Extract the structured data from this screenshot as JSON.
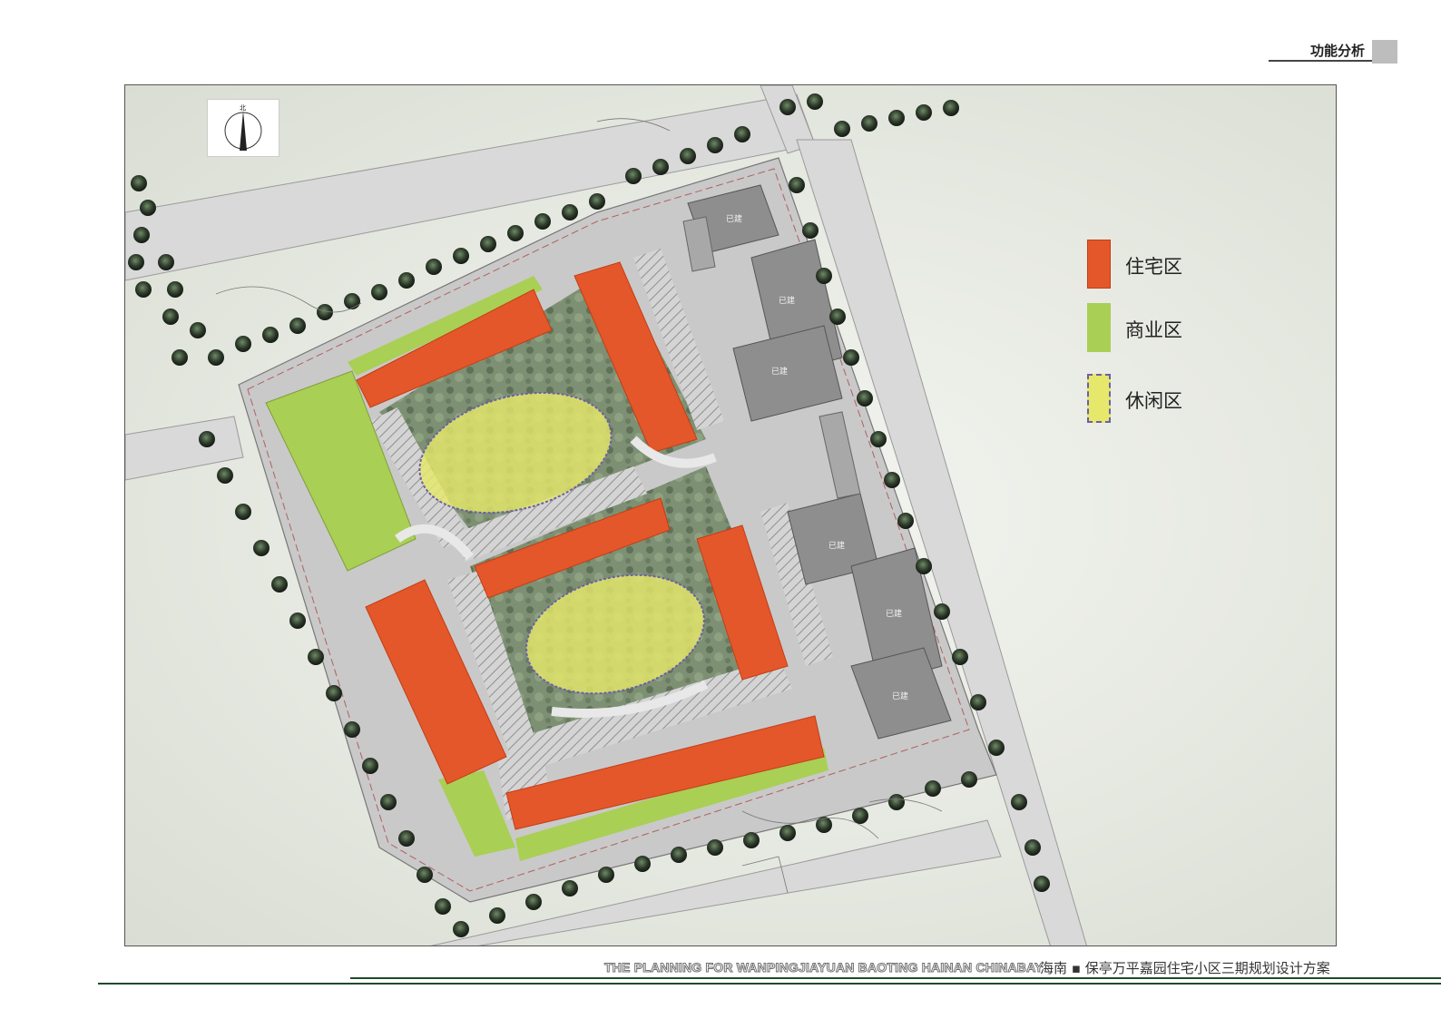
{
  "header": {
    "title": "功能分析"
  },
  "legend": {
    "items": [
      {
        "label": "住宅区",
        "color": "#e4572b",
        "border": "#c43d14"
      },
      {
        "label": "商业区",
        "color": "#a9cf55",
        "border": "#a9cf55"
      },
      {
        "label": "休闲区",
        "color": "#e5e86a",
        "border": "#6c5fa8"
      }
    ]
  },
  "plan": {
    "existing_building_label": "已建",
    "compass_label": "北"
  },
  "footer": {
    "english": "THE PLANNING FOR WANPINGJIAYUAN BAOTING HAINAN CHINABAY",
    "chinese": "海南 ▪ 保亭万平嘉园住宅小区三期规划设计方案"
  }
}
